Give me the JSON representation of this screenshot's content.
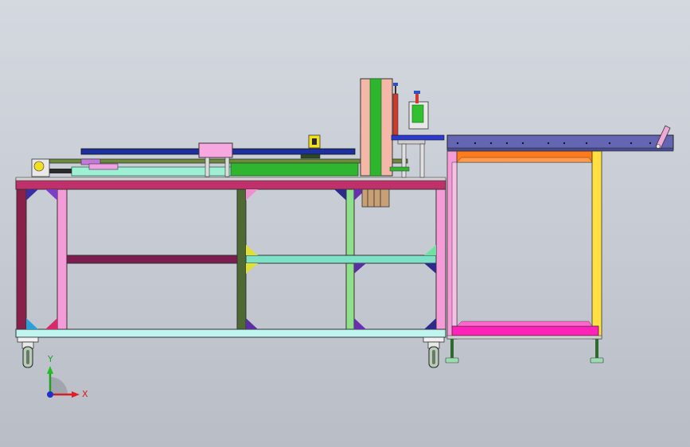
{
  "triad": {
    "x_label": "X",
    "y_label": "Y"
  },
  "colors": {
    "background": "#c9cdd5",
    "frame_top_beam": "#c0306a",
    "frame_left_post": "#8a1f4a",
    "frame_post_pink": "#f59bd8",
    "frame_post_olive": "#4e6a32",
    "frame_post_green": "#8ee08a",
    "frame_mid_beam_left": "#7b1d4f",
    "frame_mid_beam_right": "#7fe0c8",
    "frame_bottom_beam": "#bff5ee",
    "conveyor_blue": "#1e2fa0",
    "conveyor_green": "#2fb52f",
    "outfeed_table": "#6466b3",
    "outfeed_frame_orange": "#ff7a1a",
    "outfeed_frame_yellow": "#ffe040",
    "outfeed_frame_magenta": "#ff22b8",
    "tower_salmon": "#f5b8a8",
    "tower_green": "#2db52d"
  },
  "icons": [
    "coordinate-triad-icon",
    "caster-wheel-icon",
    "leveling-foot-icon"
  ]
}
